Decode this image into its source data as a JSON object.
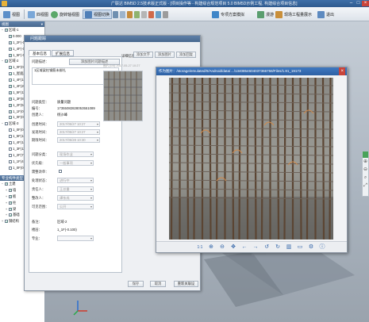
{
  "window": {
    "title": "广联达 BIM5D 2.5技术版正式版 - [项目操作等 - 构建综合规范项目 5.0 BIM5D示例工程, 构建综合项目信息]"
  },
  "toolbar": {
    "items": [
      "视图",
      "四视图",
      "旋转轴视图",
      "视图切换",
      "专项方案模拟",
      "漫游",
      "现场工程量展示",
      "退出"
    ]
  },
  "tree": {
    "header": "视图",
    "top_items": [
      {
        "label": "区域-1",
        "level": 0,
        "checked": true,
        "expand": "−"
      },
      {
        "label": "0.000",
        "level": 1,
        "checked": true,
        "expand": ""
      },
      {
        "label": "1_2F(-0.1…",
        "level": 1,
        "checked": true,
        "expand": ""
      },
      {
        "label": "1_4F(-0.1…",
        "level": 1,
        "checked": true,
        "expand": ""
      },
      {
        "label": "1_5F(-0.1…",
        "level": 1,
        "checked": true,
        "expand": ""
      },
      {
        "label": "区域-2",
        "level": 0,
        "checked": true,
        "expand": "−"
      },
      {
        "label": "1_0F(0.00…",
        "level": 1,
        "checked": true,
        "expand": ""
      },
      {
        "label": "1_屋面层…",
        "level": 1,
        "checked": true,
        "expand": ""
      },
      {
        "label": "1_4F(15.1…",
        "level": 1,
        "checked": true,
        "expand": ""
      },
      {
        "label": "1_4F(20.1…",
        "level": 1,
        "checked": true,
        "expand": ""
      },
      {
        "label": "1_5F(11.0…",
        "level": 1,
        "checked": true,
        "expand": ""
      },
      {
        "label": "1_3F(8.00…",
        "level": 1,
        "checked": true,
        "expand": ""
      },
      {
        "label": "1_2F(5.00…",
        "level": 1,
        "checked": true,
        "expand": ""
      },
      {
        "label": "1_1F(0.00…",
        "level": 1,
        "checked": true,
        "expand": ""
      },
      {
        "label": "1_0F(0.00…",
        "level": 1,
        "checked": true,
        "expand": ""
      },
      {
        "label": "区域-3",
        "level": 0,
        "checked": false,
        "expand": "−"
      },
      {
        "label": "1_0F(0.00…",
        "level": 1,
        "checked": false,
        "expand": ""
      },
      {
        "label": "1_5F(18.0…",
        "level": 1,
        "checked": false,
        "expand": ""
      },
      {
        "label": "1_4F(14.5…",
        "level": 1,
        "checked": false,
        "expand": ""
      },
      {
        "label": "1_3F(11.0…",
        "level": 1,
        "checked": false,
        "expand": ""
      },
      {
        "label": "1_2F(7.00…",
        "level": 1,
        "checked": false,
        "expand": ""
      },
      {
        "label": "1_1F(4.00…",
        "level": 1,
        "checked": false,
        "expand": ""
      },
      {
        "label": "1_0F(0.00…",
        "level": 1,
        "checked": false,
        "expand": ""
      }
    ],
    "lower_header": "专业构件类型",
    "lower_items": [
      {
        "label": "土建",
        "level": 0,
        "checked": true,
        "expand": "−"
      },
      {
        "label": "墙",
        "level": 1,
        "checked": true,
        "expand": "+"
      },
      {
        "label": "板",
        "level": 1,
        "checked": true,
        "expand": "+"
      },
      {
        "label": "柱",
        "level": 1,
        "checked": true,
        "expand": "+"
      },
      {
        "label": "梁",
        "level": 1,
        "checked": true,
        "expand": "+"
      },
      {
        "label": "基础",
        "level": 1,
        "checked": true,
        "expand": "+"
      },
      {
        "label": "钢结构",
        "level": 0,
        "checked": true,
        "expand": "+"
      }
    ]
  },
  "issue_dialog": {
    "title": "问题跟踪",
    "tabs": [
      "基本信息",
      "扩展信息"
    ],
    "record_tab": "详细信息",
    "fields": {
      "desc_label": "问题描述：",
      "desc_link": "添加图片问题描述",
      "desc_value": "1区域梁柱钢筋未绑扎",
      "type_label": "问题类型：",
      "type_value": "质量问题",
      "id_label": "编号：",
      "id_value": "17355082828053551089",
      "creator_label": "创建人：",
      "creator_value": "杨沙峰",
      "created_label": "创建时间：",
      "created_value": "2017/05/27 10:27",
      "found_label": "发现时间：",
      "found_value": "2017/05/27 10:27",
      "deadline_label": "期限时间：",
      "deadline_value": "2017/05/28 10:30",
      "category_label": "问题分类：",
      "category_value": "现场作业",
      "priority_label": "优先级：",
      "priority_value": "一般事项",
      "rectify_label": "需整改单：",
      "status_label": "处理状态：",
      "status_value": "进行中",
      "handler_label": "责任人：",
      "handler_value": "王总量",
      "reviewer_label": "整改人：",
      "reviewer_value": "谭东成",
      "visibility_label": "可见范围：",
      "visibility_value": "公开",
      "remark_label": "备注：",
      "remark_value": "区域-2",
      "floor_label": "楼层：",
      "floor_value": "1_1F(-0.100)",
      "profession_label": "专业："
    },
    "side_buttons": [
      "添加文字",
      "添加图片",
      "添加回复"
    ],
    "thumb_caption": "图片(1/4) 2017-05-27 10:27",
    "bottom_buttons": [
      "保存",
      "取消",
      "重新关联设"
    ]
  },
  "viewer": {
    "title": "作为图片：/storage/emulated/0/Android/data/…/1340854604037366758/Files/1.81_19173",
    "controls": [
      "1:1",
      "zoom-in-icon",
      "zoom-out-icon",
      "pan-icon",
      "prev-icon",
      "next-icon",
      "rotate-left-icon",
      "rotate-right-icon",
      "delete-icon",
      "folder-icon",
      "settings-icon",
      "info-icon"
    ]
  },
  "colors": {
    "title_bar": "#2e5a8f",
    "panel_header": "#49698f",
    "viewer_header": "#2d60a4",
    "accent_icon": "#2f63a8"
  }
}
